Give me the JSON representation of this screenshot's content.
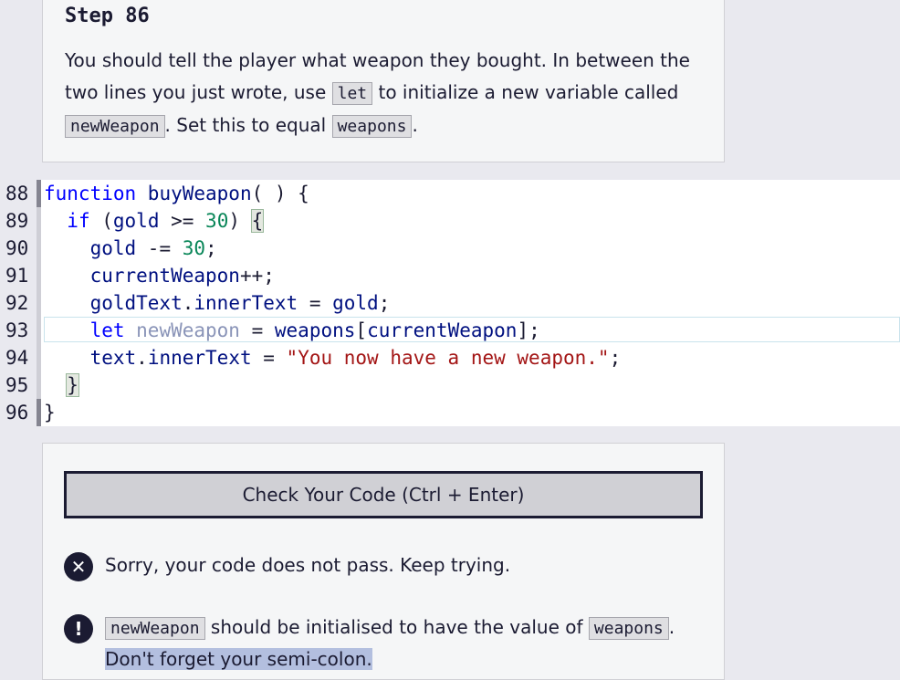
{
  "description": {
    "step_title": "Step 86",
    "line1": "You should tell the player what weapon they bought. In between the",
    "line2_before": "two lines you just wrote, use ",
    "line2_code": "let",
    "line2_after": " to initialize a new variable called",
    "line3_code1": "newWeapon",
    "line3_mid": ". Set this to equal ",
    "line3_code2": "weapons",
    "line3_end": "."
  },
  "editor": {
    "lines": [
      {
        "num": "88",
        "tokens": [
          {
            "t": "function",
            "c": "kw"
          },
          {
            "t": " buyWeapon",
            "c": "id"
          },
          {
            "t": "( ) {",
            "c": ""
          }
        ]
      },
      {
        "num": "89",
        "tokens": [
          {
            "t": "  ",
            "c": ""
          },
          {
            "t": "if",
            "c": "kw"
          },
          {
            "t": " (",
            "c": ""
          },
          {
            "t": "gold",
            "c": "id"
          },
          {
            "t": " >= ",
            "c": ""
          },
          {
            "t": "30",
            "c": "num"
          },
          {
            "t": ") ",
            "c": ""
          },
          {
            "t": "{",
            "c": "bm"
          }
        ]
      },
      {
        "num": "90",
        "tokens": [
          {
            "t": "    ",
            "c": ""
          },
          {
            "t": "gold",
            "c": "id"
          },
          {
            "t": " -= ",
            "c": ""
          },
          {
            "t": "30",
            "c": "num"
          },
          {
            "t": ";",
            "c": ""
          }
        ]
      },
      {
        "num": "91",
        "tokens": [
          {
            "t": "    ",
            "c": ""
          },
          {
            "t": "currentWeapon",
            "c": "id"
          },
          {
            "t": "++;",
            "c": ""
          }
        ]
      },
      {
        "num": "92",
        "tokens": [
          {
            "t": "    ",
            "c": ""
          },
          {
            "t": "goldText",
            "c": "id"
          },
          {
            "t": ".",
            "c": ""
          },
          {
            "t": "innerText",
            "c": "id"
          },
          {
            "t": " = ",
            "c": ""
          },
          {
            "t": "gold",
            "c": "id"
          },
          {
            "t": ";",
            "c": ""
          }
        ]
      },
      {
        "num": "93",
        "tokens": [
          {
            "t": "    ",
            "c": ""
          },
          {
            "t": "let",
            "c": "kw"
          },
          {
            "t": " newWeapon",
            "c": "ghost"
          },
          {
            "t": " = ",
            "c": ""
          },
          {
            "t": "weapons",
            "c": "id"
          },
          {
            "t": "[",
            "c": ""
          },
          {
            "t": "currentWeapon",
            "c": "id"
          },
          {
            "t": "];",
            "c": ""
          }
        ]
      },
      {
        "num": "94",
        "tokens": [
          {
            "t": "    ",
            "c": ""
          },
          {
            "t": "text",
            "c": "id"
          },
          {
            "t": ".",
            "c": ""
          },
          {
            "t": "innerText",
            "c": "id"
          },
          {
            "t": " = ",
            "c": ""
          },
          {
            "t": "\"You now have a new weapon.\"",
            "c": "str"
          },
          {
            "t": ";",
            "c": ""
          }
        ]
      },
      {
        "num": "95",
        "tokens": [
          {
            "t": "  ",
            "c": ""
          },
          {
            "t": "}",
            "c": "bm"
          }
        ]
      },
      {
        "num": "96",
        "tokens": [
          {
            "t": "}",
            "c": ""
          }
        ]
      }
    ]
  },
  "check": {
    "button_label": "Check Your Code (Ctrl + Enter)"
  },
  "feedback": {
    "fail_message": "Sorry, your code does not pass. Keep trying.",
    "hint_code1": "newWeapon",
    "hint_mid": " should be initialised to have the value of ",
    "hint_code2": "weapons",
    "hint_end": ".",
    "hint_line2": "Don't forget your semi-colon."
  }
}
